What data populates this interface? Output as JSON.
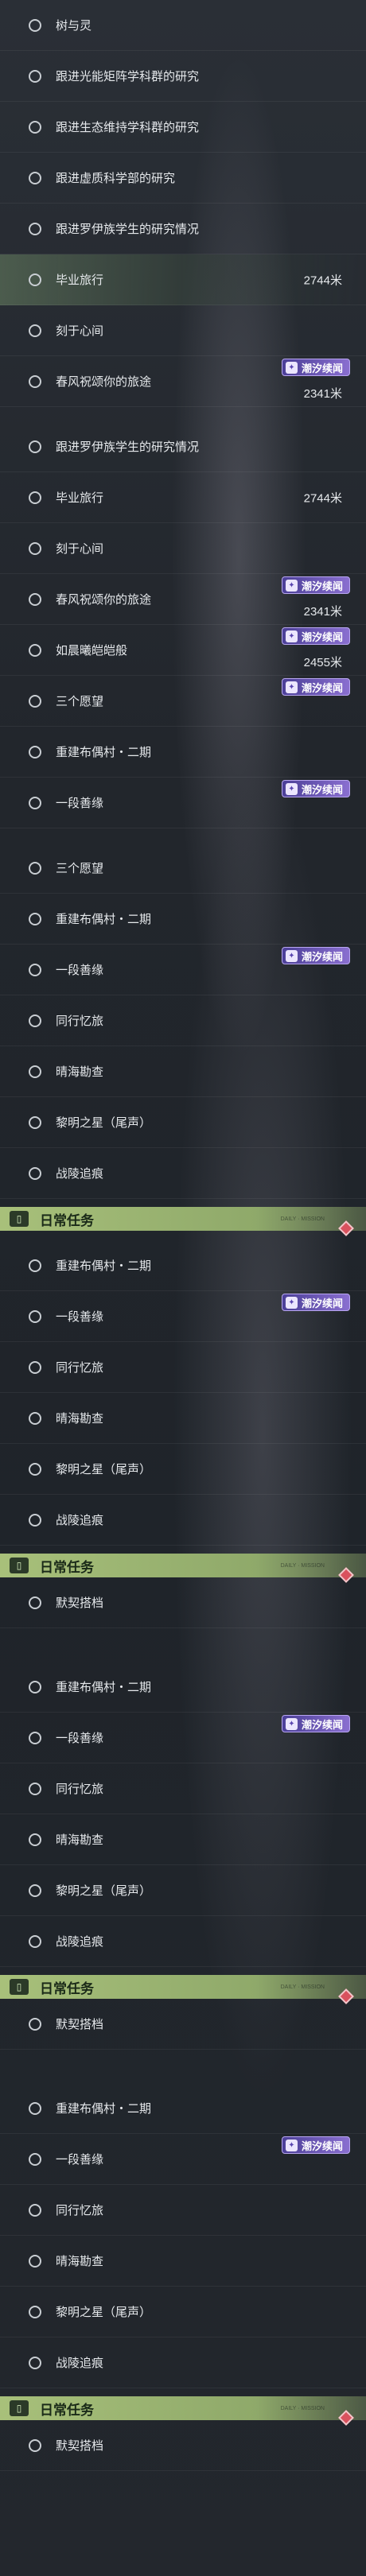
{
  "badge_text": "潮汐续闻",
  "badge_icon": "book-icon",
  "section_title": "日常任务",
  "section_small": "DAILY · MISSION",
  "panels": [
    {
      "rows": [
        {
          "label": "树与灵"
        },
        {
          "label": "跟进光能矩阵学科群的研究"
        },
        {
          "label": "跟进生态维持学科群的研究"
        },
        {
          "label": "跟进虚质科学部的研究"
        },
        {
          "label": "跟进罗伊族学生的研究情况"
        },
        {
          "label": "毕业旅行",
          "dist": "2744米",
          "hl": true
        },
        {
          "label": "刻于心间"
        },
        {
          "label": "春风祝颂你的旅途",
          "dist": "2341米",
          "badge": true
        }
      ]
    },
    {
      "rows": [
        {
          "label": "跟进罗伊族学生的研究情况"
        },
        {
          "label": "毕业旅行",
          "dist": "2744米"
        },
        {
          "label": "刻于心间"
        },
        {
          "label": "春风祝颂你的旅途",
          "dist": "2341米",
          "badge": true
        },
        {
          "label": "如晨曦皑皑般",
          "dist": "2455米",
          "badge": true
        },
        {
          "label": "三个愿望",
          "badge": true
        },
        {
          "label": "重建布偶村・二期"
        },
        {
          "label": "一段善缘",
          "badge": true
        }
      ]
    },
    {
      "rows": [
        {
          "label": "三个愿望"
        },
        {
          "label": "重建布偶村・二期"
        },
        {
          "label": "一段善缘",
          "badge": true
        },
        {
          "label": "同行忆旅"
        },
        {
          "label": "晴海勘查"
        },
        {
          "label": "黎明之星（尾声）"
        },
        {
          "label": "战陵追痕"
        }
      ],
      "section": true
    },
    {
      "rows": [
        {
          "label": "重建布偶村・二期"
        },
        {
          "label": "一段善缘",
          "badge": true
        },
        {
          "label": "同行忆旅"
        },
        {
          "label": "晴海勘查"
        },
        {
          "label": "黎明之星（尾声）"
        },
        {
          "label": "战陵追痕"
        }
      ],
      "section": true,
      "after": [
        {
          "label": "默契搭档"
        }
      ]
    },
    {
      "rows": [
        {
          "label": "重建布偶村・二期"
        },
        {
          "label": "一段善缘",
          "badge": true
        },
        {
          "label": "同行忆旅"
        },
        {
          "label": "晴海勘查"
        },
        {
          "label": "黎明之星（尾声）"
        },
        {
          "label": "战陵追痕"
        }
      ],
      "section": true,
      "after": [
        {
          "label": "默契搭档"
        }
      ]
    },
    {
      "rows": [
        {
          "label": "重建布偶村・二期"
        },
        {
          "label": "一段善缘",
          "badge": true
        },
        {
          "label": "同行忆旅"
        },
        {
          "label": "晴海勘查"
        },
        {
          "label": "黎明之星（尾声）"
        },
        {
          "label": "战陵追痕"
        }
      ],
      "section": true,
      "after": [
        {
          "label": "默契搭档"
        }
      ]
    }
  ]
}
